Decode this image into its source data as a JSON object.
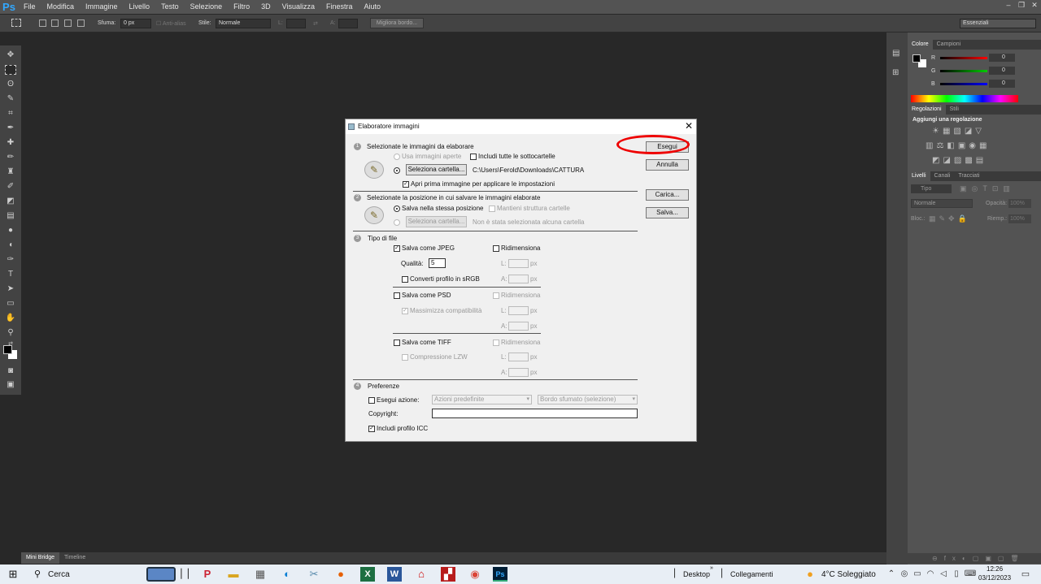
{
  "app": {
    "logo": "Ps",
    "menu": [
      "File",
      "Modifica",
      "Immagine",
      "Livello",
      "Testo",
      "Selezione",
      "Filtro",
      "3D",
      "Visualizza",
      "Finestra",
      "Aiuto"
    ]
  },
  "options": {
    "feather_label": "Sfuma:",
    "feather_value": "0 px",
    "antialias": "Anti-alias",
    "style_label": "Stile:",
    "style_value": "Normale",
    "width_label": "L:",
    "height_label": "A:",
    "refine_edge": "Migliora bordo...",
    "workspace": "Essenziali"
  },
  "panels": {
    "color_tabs": [
      "Colore",
      "Campioni"
    ],
    "rgb": [
      {
        "label": "R",
        "value": "0"
      },
      {
        "label": "G",
        "value": "0"
      },
      {
        "label": "B",
        "value": "0"
      }
    ],
    "adjust_tabs": [
      "Regolazioni",
      "Stili"
    ],
    "adjust_title": "Aggiungi una regolazione",
    "layers_tabs": [
      "Livelli",
      "Canali",
      "Tracciati"
    ],
    "kind": "Tipo",
    "blend": "Normale",
    "opacity_label": "Opacità:",
    "opacity_value": "100%",
    "lock_label": "Bloc.:",
    "fill_label": "Riemp.:",
    "fill_value": "100%"
  },
  "bottom_tabs": [
    "Mini Bridge",
    "Timeline"
  ],
  "dialog": {
    "title": "Elaboratore immagini",
    "s1": {
      "num": "1",
      "title": "Selezionate le immagini da elaborare",
      "use_open": "Usa immagini aperte",
      "include_sub": "Includi tutte le sottocartelle",
      "select_folder": "Seleziona cartella...",
      "path": "C:\\Users\\Ferold\\Downloads\\CATTURA",
      "open_first": "Apri prima immagine per applicare le impostazioni"
    },
    "s2": {
      "num": "2",
      "title": "Selezionate la posizione in cui salvare le immagini elaborate",
      "same": "Salva nella stessa posizione",
      "keep": "Mantieni struttura cartelle",
      "select_folder": "Seleziona cartella...",
      "none": "Non è stata selezionata alcuna cartella"
    },
    "s3": {
      "num": "3",
      "title": "Tipo di file",
      "jpeg": "Salva come JPEG",
      "resize": "Ridimensiona",
      "quality_label": "Qualità:",
      "quality_value": "5",
      "srgb": "Converti profilo in sRGB",
      "psd": "Salva come PSD",
      "maximize": "Massimizza compatibilità",
      "tiff": "Salva come TIFF",
      "lzw": "Compressione LZW",
      "w": "L:",
      "h": "A:",
      "px": "px"
    },
    "s4": {
      "num": "4",
      "title": "Preferenze",
      "run_action": "Esegui azione:",
      "action_set": "Azioni predefinite",
      "action": "Bordo sfumato (selezione)",
      "copyright": "Copyright:",
      "icc": "Includi profilo ICC"
    },
    "buttons": {
      "run": "Esegui",
      "cancel": "Annulla",
      "load": "Carica...",
      "save": "Salva..."
    }
  },
  "taskbar": {
    "search": "Cerca",
    "desktop": "Desktop",
    "links": "Collegamenti",
    "weather": "4°C  Soleggiato",
    "time": "12:26",
    "date": "03/12/2023"
  }
}
